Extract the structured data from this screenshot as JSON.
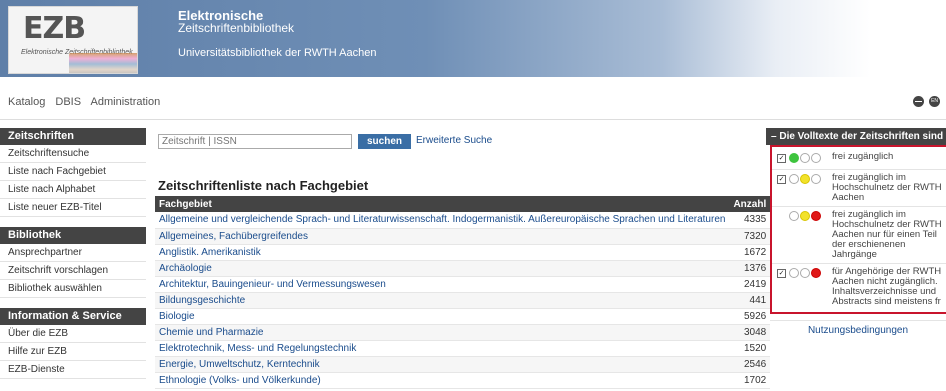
{
  "header": {
    "logo_text": "EZB",
    "logo_subtitle": "Elektronische Zeitschriftenbibliothek",
    "title_line1": "Elektronische",
    "title_line2": "Zeitschriftenbibliothek",
    "university": "Universitätsbibliothek der RWTH Aachen"
  },
  "topnav": {
    "items": [
      "Katalog",
      "DBIS",
      "Administration"
    ],
    "icons": [
      "minus-circle-icon",
      "language-en-icon"
    ],
    "lang_label": "EN"
  },
  "sidebar": {
    "sections": [
      {
        "title": "Zeitschriften",
        "items": [
          "Zeitschriftensuche",
          "Liste nach Fachgebiet",
          "Liste nach Alphabet",
          "Liste neuer EZB-Titel"
        ]
      },
      {
        "title": "Bibliothek",
        "items": [
          "Ansprechpartner",
          "Zeitschrift vorschlagen",
          "Bibliothek auswählen"
        ]
      },
      {
        "title": "Information & Service",
        "items": [
          "Über die EZB",
          "Hilfe zur EZB",
          "EZB-Dienste"
        ]
      }
    ]
  },
  "search": {
    "placeholder": "Zeitschrift | ISSN",
    "button_label": "suchen",
    "advanced_link": "Erweiterte Suche"
  },
  "main": {
    "title": "Zeitschriftenliste nach Fachgebiet",
    "columns": [
      "Fachgebiet",
      "Anzahl"
    ],
    "rows": [
      {
        "subject": "Allgemeine und vergleichende Sprach- und Literaturwissenschaft. Indogermanistik. Außereuropäische Sprachen und Literaturen",
        "count": "4335"
      },
      {
        "subject": "Allgemeines, Fachübergreifendes",
        "count": "7320"
      },
      {
        "subject": "Anglistik. Amerikanistik",
        "count": "1672"
      },
      {
        "subject": "Archäologie",
        "count": "1376"
      },
      {
        "subject": "Architektur, Bauingenieur- und Vermessungswesen",
        "count": "2419"
      },
      {
        "subject": "Bildungsgeschichte",
        "count": "441"
      },
      {
        "subject": "Biologie",
        "count": "5926"
      },
      {
        "subject": "Chemie und Pharmazie",
        "count": "3048"
      },
      {
        "subject": "Elektrotechnik, Mess- und Regelungstechnik",
        "count": "1520"
      },
      {
        "subject": "Energie, Umweltschutz, Kerntechnik",
        "count": "2546"
      },
      {
        "subject": "Ethnologie (Volks- und Völkerkunde)",
        "count": "1702"
      }
    ]
  },
  "legend": {
    "title": "Die Volltexte der Zeitschriften sind",
    "collapse_symbol": "–",
    "items": [
      {
        "checked": true,
        "show_checkbox": true,
        "lights": [
          "g",
          "o",
          "o"
        ],
        "text": [
          "frei zugänglich"
        ]
      },
      {
        "checked": true,
        "show_checkbox": true,
        "lights": [
          "o",
          "y",
          "o"
        ],
        "text": [
          "frei zugänglich im",
          "Hochschulnetz der RWTH",
          "Aachen"
        ]
      },
      {
        "checked": false,
        "show_checkbox": false,
        "lights": [
          "o",
          "y",
          "r"
        ],
        "text": [
          "frei zugänglich im",
          "Hochschulnetz der RWTH",
          "Aachen nur für einen Teil",
          "der erschienenen",
          "Jahrgänge"
        ]
      },
      {
        "checked": true,
        "show_checkbox": true,
        "lights": [
          "o",
          "o",
          "r"
        ],
        "text": [
          "für Angehörige der RWTH",
          "Aachen nicht zugänglich.",
          "Inhaltsverzeichnisse und",
          "Abstracts sind meistens fr"
        ]
      }
    ],
    "terms_link": "Nutzungsbedingungen"
  },
  "colors": {
    "header_blue": "#5f7fa8",
    "dark_bar": "#444444",
    "link_blue": "#1a4c8c",
    "button_blue": "#3a6ea5",
    "legend_border_red": "#c8142c"
  }
}
